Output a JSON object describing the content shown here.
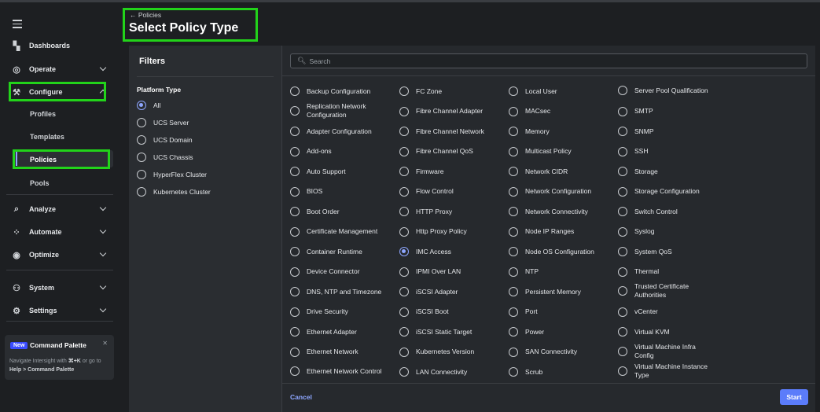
{
  "sidebar": {
    "nav": [
      {
        "label": "Dashboards",
        "icon": "dashboards-icon"
      },
      {
        "label": "Operate",
        "icon": "operate-icon"
      },
      {
        "label": "Configure",
        "icon": "configure-icon"
      },
      {
        "label": "Analyze",
        "icon": "analyze-icon"
      },
      {
        "label": "Automate",
        "icon": "automate-icon"
      },
      {
        "label": "Optimize",
        "icon": "optimize-icon"
      },
      {
        "label": "System",
        "icon": "system-icon"
      },
      {
        "label": "Settings",
        "icon": "settings-icon"
      }
    ],
    "configure_sub": [
      "Profiles",
      "Templates",
      "Policies",
      "Pools"
    ],
    "palette": {
      "badge": "New",
      "title": "Command Palette",
      "desc_pre": "Navigate Intersight with",
      "shortcut": "⌘+K",
      "desc_mid": "or go to",
      "path": "Help > Command Palette"
    }
  },
  "header": {
    "back_label": "← Policies",
    "title": "Select Policy Type"
  },
  "filters": {
    "title": "Filters",
    "group_label": "Platform Type",
    "options": [
      "All",
      "UCS Server",
      "UCS Domain",
      "UCS Chassis",
      "HyperFlex Cluster",
      "Kubernetes Cluster"
    ],
    "selected": "All"
  },
  "search": {
    "placeholder": "Search"
  },
  "policy_columns": [
    [
      "Backup Configuration",
      "Replication Network Configuration",
      "Adapter Configuration",
      "Add-ons",
      "Auto Support",
      "BIOS",
      "Boot Order",
      "Certificate Management",
      "Container Runtime",
      "Device Connector",
      "DNS, NTP and Timezone",
      "Drive Security",
      "Ethernet Adapter",
      "Ethernet Network",
      "Ethernet Network Control"
    ],
    [
      "FC Zone",
      "Fibre Channel Adapter",
      "Fibre Channel Network",
      "Fibre Channel QoS",
      "Firmware",
      "Flow Control",
      "HTTP Proxy",
      "Http Proxy Policy",
      "IMC Access",
      "IPMI Over LAN",
      "iSCSI Adapter",
      "iSCSI Boot",
      "iSCSI Static Target",
      "Kubernetes Version",
      "LAN Connectivity"
    ],
    [
      "Local User",
      "MACsec",
      "Memory",
      "Multicast Policy",
      "Network CIDR",
      "Network Configuration",
      "Network Connectivity",
      "Node IP Ranges",
      "Node OS Configuration",
      "NTP",
      "Persistent Memory",
      "Port",
      "Power",
      "SAN Connectivity",
      "Scrub"
    ],
    [
      "Server Pool Qualification",
      "SMTP",
      "SNMP",
      "SSH",
      "Storage",
      "Storage Configuration",
      "Switch Control",
      "Syslog",
      "System QoS",
      "Thermal",
      "Trusted Certificate Authorities",
      "vCenter",
      "Virtual KVM",
      "Virtual Machine Infra Config",
      "Virtual Machine Instance Type"
    ]
  ],
  "selected_policy": "IMC Access",
  "footer": {
    "cancel_label": "Cancel",
    "start_label": "Start"
  },
  "colors": {
    "accent": "#8ea6ff",
    "highlight": "#22d31a",
    "primary_button": "#5b7cfa"
  }
}
